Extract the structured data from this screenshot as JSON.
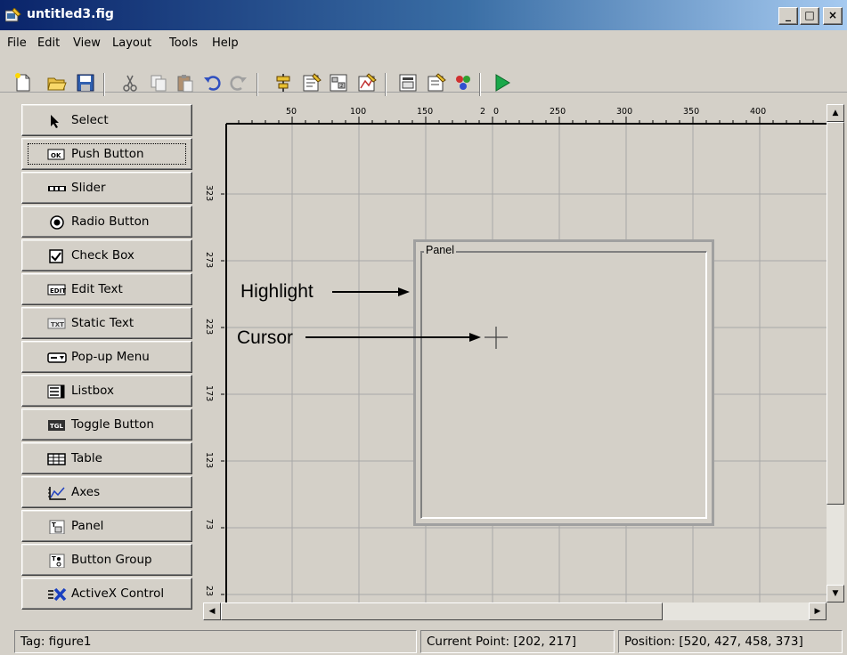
{
  "window": {
    "title": "untitled3.fig",
    "minimize": "_",
    "maximize": "□",
    "close": "×"
  },
  "menu": [
    "File",
    "Edit",
    "View",
    "Layout",
    "Tools",
    "Help"
  ],
  "toolbar_icons": [
    "new-file-icon",
    "open-folder-icon",
    "save-icon",
    "cut-icon",
    "copy-icon",
    "paste-icon",
    "undo-icon",
    "redo-icon",
    "align-objects-icon",
    "menu-editor-icon",
    "tab-order-editor-icon",
    "m-file-editor-icon",
    "property-inspector-icon",
    "object-browser-icon",
    "toolbar-editor-icon",
    "run-icon"
  ],
  "palette": [
    {
      "label": "Select",
      "icon": "arrow-cursor-icon"
    },
    {
      "label": "Push Button",
      "icon": "push-button-icon",
      "selected": true
    },
    {
      "label": "Slider",
      "icon": "slider-icon"
    },
    {
      "label": "Radio Button",
      "icon": "radio-button-icon"
    },
    {
      "label": "Check Box",
      "icon": "check-box-icon"
    },
    {
      "label": "Edit Text",
      "icon": "edit-text-icon"
    },
    {
      "label": "Static Text",
      "icon": "static-text-icon"
    },
    {
      "label": "Pop-up Menu",
      "icon": "popup-menu-icon"
    },
    {
      "label": "Listbox",
      "icon": "listbox-icon"
    },
    {
      "label": "Toggle Button",
      "icon": "toggle-button-icon"
    },
    {
      "label": "Table",
      "icon": "table-icon"
    },
    {
      "label": "Axes",
      "icon": "axes-icon"
    },
    {
      "label": "Panel",
      "icon": "panel-icon"
    },
    {
      "label": "Button Group",
      "icon": "button-group-icon"
    },
    {
      "label": "ActiveX Control",
      "icon": "activex-control-icon"
    }
  ],
  "ruler": {
    "top_ticks": [
      "50",
      "100",
      "150",
      "2",
      "0",
      "250",
      "300",
      "350",
      "400"
    ],
    "left_ticks": [
      "323",
      "273",
      "223",
      "173",
      "123",
      "73",
      "23"
    ]
  },
  "canvas": {
    "panel_title": "Panel",
    "annotation_highlight": "Highlight",
    "annotation_cursor": "Cursor"
  },
  "status": {
    "tag": "Tag: figure1",
    "current_point": "Current Point:  [202, 217]",
    "position": "Position: [520, 427, 458, 373]"
  },
  "colors": {
    "titlebar_start": "#0a246a",
    "titlebar_end": "#a6caf0",
    "face": "#d4d0c8",
    "grid": "#a8a8a8",
    "run_green": "#1aa84a"
  }
}
